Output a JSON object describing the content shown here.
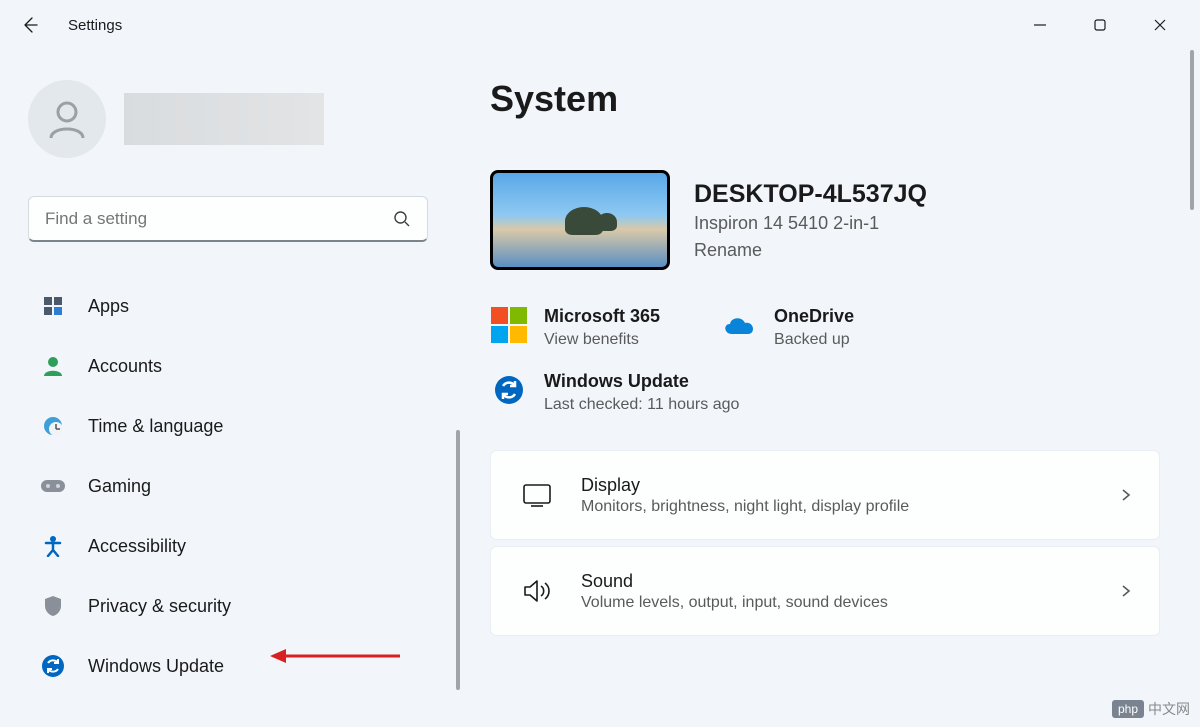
{
  "app": {
    "title": "Settings"
  },
  "search": {
    "placeholder": "Find a setting"
  },
  "nav": {
    "items": [
      {
        "label": "Apps"
      },
      {
        "label": "Accounts"
      },
      {
        "label": "Time & language"
      },
      {
        "label": "Gaming"
      },
      {
        "label": "Accessibility"
      },
      {
        "label": "Privacy & security"
      },
      {
        "label": "Windows Update"
      }
    ]
  },
  "main": {
    "title": "System",
    "device": {
      "name": "DESKTOP-4L537JQ",
      "model": "Inspiron 14 5410 2-in-1",
      "rename": "Rename"
    },
    "status": {
      "m365": {
        "title": "Microsoft 365",
        "sub": "View benefits"
      },
      "onedrive": {
        "title": "OneDrive",
        "sub": "Backed up"
      },
      "update": {
        "title": "Windows Update",
        "sub": "Last checked: 11 hours ago"
      }
    },
    "cards": [
      {
        "title": "Display",
        "sub": "Monitors, brightness, night light, display profile"
      },
      {
        "title": "Sound",
        "sub": "Volume levels, output, input, sound devices"
      }
    ]
  },
  "watermark": {
    "badge": "php",
    "text": "中文网"
  }
}
